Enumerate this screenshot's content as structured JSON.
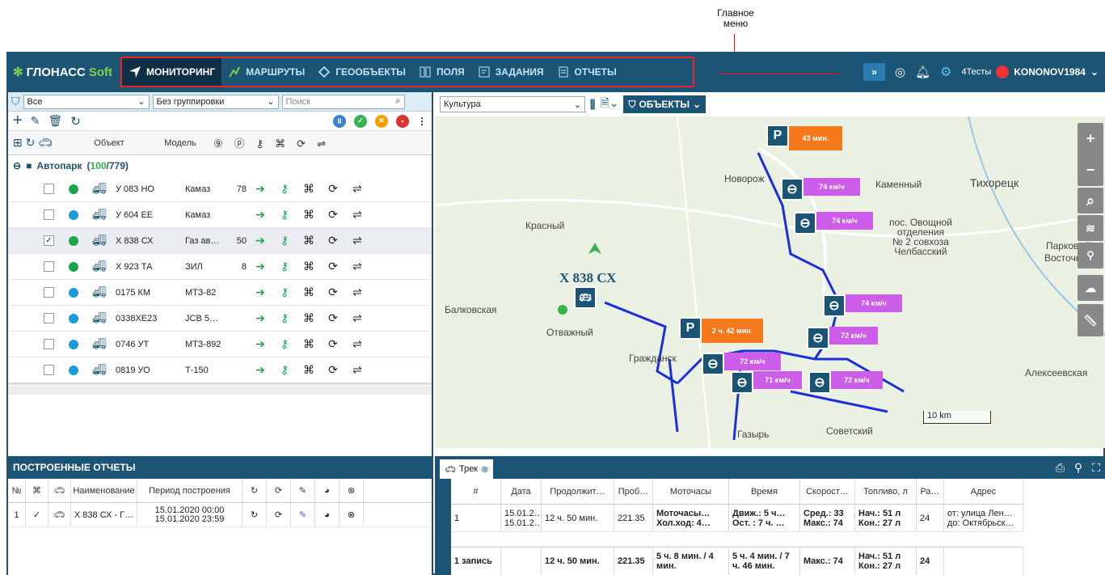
{
  "callout": {
    "line1": "Главное",
    "line2": "меню"
  },
  "brand": {
    "name_a": "ГЛОНАСС",
    "name_b": "Soft",
    "accent": "#8bd04a",
    "bar": "#1b5475"
  },
  "menu": {
    "items": [
      {
        "label": "МОНИТОРИНГ",
        "icon": "navigation-arrow-icon"
      },
      {
        "label": "МАРШРУТЫ",
        "icon": "route-icon"
      },
      {
        "label": "ГЕООБЪЕКТЫ",
        "icon": "geoobject-icon"
      },
      {
        "label": "ПОЛЯ",
        "icon": "fields-icon"
      },
      {
        "label": "ЗАДАНИЯ",
        "icon": "tasks-icon"
      },
      {
        "label": "ОТЧЕТЫ",
        "icon": "reports-icon"
      }
    ],
    "more": "»",
    "account": "4Тесты",
    "user": "KONONOV1984"
  },
  "objects": {
    "filter": "Все",
    "grouping": "Без группировки",
    "search_placeholder": "Поиск",
    "headers": {
      "object": "Объект",
      "model": "Модель"
    },
    "group": {
      "name": "Автопарк",
      "online": "100",
      "total": "/779)",
      "open": "("
    },
    "rows": [
      {
        "plate": "У 083 НО",
        "model": "Камаз",
        "num": "78",
        "dot": "#1aa64a",
        "checked": ""
      },
      {
        "plate": "У 604 ЕЕ",
        "model": "Камаз",
        "num": "",
        "dot": "#1a9ad6",
        "checked": ""
      },
      {
        "plate": "Х 838 СХ",
        "model": "Газ ав…",
        "num": "50",
        "dot": "#1aa64a",
        "checked": "✓"
      },
      {
        "plate": "Х 923 ТА",
        "model": "ЗИЛ",
        "num": "8",
        "dot": "#1aa64a",
        "checked": ""
      },
      {
        "plate": "0175 КМ",
        "model": "МТЗ-82",
        "num": "",
        "dot": "#1a9ad6",
        "checked": ""
      },
      {
        "plate": "0338ХЕ23",
        "model": "JCB 5…",
        "num": "",
        "dot": "#1a9ad6",
        "checked": ""
      },
      {
        "plate": "0746 УТ",
        "model": "МТЗ-892",
        "num": "",
        "dot": "#1a9ad6",
        "checked": ""
      },
      {
        "plate": "0819 УО",
        "model": "Т-150",
        "num": "",
        "dot": "#1a9ad6",
        "checked": ""
      }
    ]
  },
  "map": {
    "layer": "Культура",
    "objects_btn": "ОБЪЕКТЫ",
    "vehicle_label": "Х 838 СХ",
    "towns": [
      "Новорож",
      "Каменный",
      "Тихорецк",
      "Красный",
      "пос. Овощной",
      "отделения",
      "№ 2 совхоза",
      "Челбасский",
      "Парковый",
      "Восточн",
      "Балковская",
      "Отважный",
      "Гражданск",
      "Алексеевская",
      "Советский",
      "Газырь"
    ],
    "scale": "10 km",
    "stops": [
      {
        "n": "6",
        "time": "43 мин."
      },
      {
        "n": "4",
        "time": "2 ч. 42 мин."
      }
    ],
    "speeds": [
      {
        "n": "6",
        "v": "74 км/ч"
      },
      {
        "n": "7",
        "v": "74 км/ч"
      },
      {
        "n": "5",
        "v": "74 км/ч"
      },
      {
        "n": "4",
        "v": "72 км/ч"
      },
      {
        "n": "2",
        "v": "72 км/ч"
      },
      {
        "n": "3",
        "v": "71 км/ч"
      },
      {
        "n": "9",
        "v": "72 км/ч"
      }
    ]
  },
  "reports": {
    "title": "ПОСТРОЕННЫЕ ОТЧЕТЫ",
    "headers": {
      "num": "№",
      "name": "Наименование",
      "period": "Период построения"
    },
    "row": {
      "num": "1",
      "name": "Х 838 СХ - Г…",
      "from": "15.01.2020 00:00",
      "to": "15.01.2020 23:59"
    }
  },
  "track": {
    "tab": "Трек",
    "headers": [
      "#",
      "Дата",
      "Продолжит…",
      "Проб…",
      "Моточасы",
      "Время",
      "Скорост…",
      "Топливо, л",
      "Ра…",
      "Адрес"
    ],
    "row": {
      "num": "1",
      "date1": "15.01.2…",
      "date2": "15.01.2…",
      "duration": "12 ч. 50 мин.",
      "mileage": "221.35",
      "moto1": "Моточасы…",
      "moto2": "Хол.ход: 4…",
      "time1": "Движ.: 5 ч…",
      "time2": "Ост. : 7 ч. …",
      "speed1": "Сред.: 33",
      "speed2": "Макс.: 74",
      "fuel1": "Нач.: 51 л",
      "fuel2": "Кон.: 27 л",
      "ra": "24",
      "addr1": "от: улица Лен…",
      "addr2": "до: Октябрьск…"
    },
    "summary": {
      "records": "1 запись",
      "duration": "12 ч. 50 мин.",
      "mileage": "221.35",
      "moto": "5 ч. 8 мин. / 4 мин.",
      "time": "5 ч. 4 мин. / 7 ч. 46 мин.",
      "speed": "Макс.: 74",
      "fuel1": "Нач.: 51 л",
      "fuel2": "Кон.: 27 л",
      "ra": "24"
    }
  }
}
